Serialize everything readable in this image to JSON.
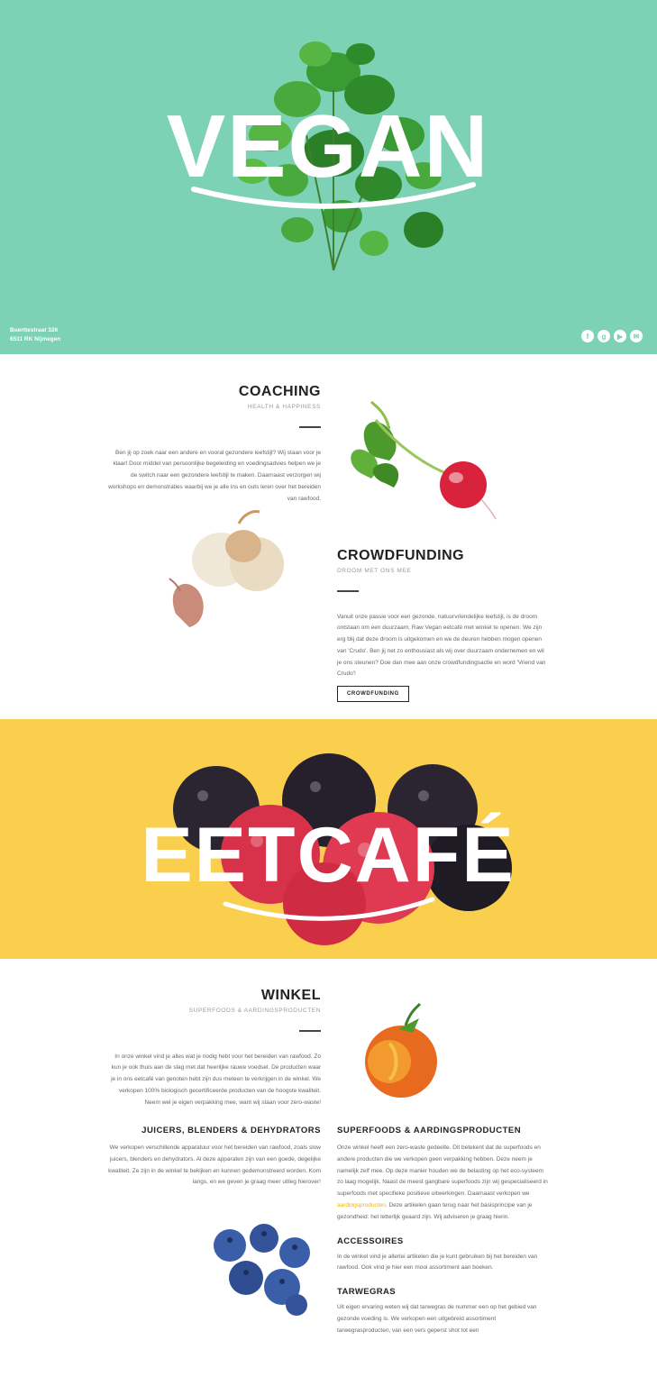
{
  "hero": {
    "title": "VEGAN",
    "address_line1": "Buerttestraat 326",
    "address_line2": "6511 RK Nijmegen",
    "bg_color": "#7dd2b5",
    "social": [
      {
        "name": "facebook-icon",
        "glyph": "f"
      },
      {
        "name": "google-plus-icon",
        "glyph": "g"
      },
      {
        "name": "youtube-icon",
        "glyph": "▶"
      },
      {
        "name": "mail-icon",
        "glyph": "✉"
      }
    ]
  },
  "coaching": {
    "title": "COACHING",
    "subtitle": "HEALTH & HAPPINESS",
    "body": "Ben jij op zoek naar een andere en vooral gezondere leefstijl? Wij staan voor je klaar! Door middel van persoonlijke begeleiding en voedingsadvies helpen we je de switch naar een gezondere leefstijl te maken. Daarnaast verzorgen wij workshops en demonstraties waarbij we je alle ins en outs leren over het bereiden van rawfood."
  },
  "crowdfunding": {
    "title": "CROWDFUNDING",
    "subtitle": "DROOM MET ONS MEE",
    "body": "Vanuit onze passie voor een gezonde, natuurvriendelijke leefstijl, is de droom ontstaan om een duurzaam, Raw Vegan eetcafé met winkel te openen. We zijn erg blij dat deze droom is uitgekomen en we de deuren hebben mogen openen van 'Crudo'. Ben jij net zo enthousiast als wij over duurzaam ondernemen en wil je ons steunen? Doe dan mee aan onze crowdfundingsactie en word 'Vriend van Crudo'!",
    "button": "CROWDFUNDING"
  },
  "banner": {
    "title": "EETCAFÉ",
    "bg_color": "#f9cf4d"
  },
  "winkel": {
    "title": "WINKEL",
    "subtitle": "SUPERFOODS & AARDINGSPRODUCTEN",
    "body": "In onze winkel vind je alles wat je nodig hebt voor het bereiden van rawfood. Zo kun je ook thuis aan de slag met dat heerlijke rauwe voedsel. De producten waar je in ons eetcafé van genoten hebt zijn dus meteen te verkrijgen in de winkel. We verkopen 100% biologisch gecertificeerde producten van de hoogste kwaliteit. Neem wel je eigen verpakking mee, want wij staan voor zero-waste!"
  },
  "juicers": {
    "title": "JUICERS, BLENDERS & DEHYDRATORS",
    "body": "We verkopen verschillende apparatuur voor het bereiden van rawfood, zoals slow juicers, blenders en dehydrators. Al deze apparaten zijn van een goede, degelijke kwaliteit. Ze zijn in de winkel te bekijken en kunnen gedemonstreerd worden. Kom langs, en we geven je graag meer uitleg hierover!"
  },
  "superfoods": {
    "title": "SUPERFOODS & AARDINGSPRODUCTEN",
    "body_pre": "Onze winkel heeft een zero-waste gedeelte. Dit betekent dat de superfoods en andere producten die we verkopen geen verpakking hebben. Deze neem je namelijk zelf mee. Op deze manier houden we de belasting op het eco-systeem zo laag mogelijk. Naast de meest gangbare superfoods zijn wij gespecialiseerd in superfoods met specifieke positieve uitwerkingen. Daarnaast verkopen we ",
    "link": "aardingsproducten",
    "body_post": ". Deze artikelen gaan terug naar het basisprincipe van je gezondheid: het letterlijk geaard zijn. Wij adviseren je graag hierin.",
    "accessoires_title": "ACCESSOIRES",
    "accessoires_body": "In de winkel vind je allerlei artikelen die je kunt gebruiken bij het bereiden van rawfood. Ook vind je hier een mooi assortiment aan boeken.",
    "tarwegras_title": "TARWEGRAS",
    "tarwegras_body": "Uit eigen ervaring weten wij dat tarwegras de nummer een op het gebied van gezonde voeding is. We verkopen een uitgebreid assortiment tarwegrasproducten, van een vers geperst shot tot een"
  }
}
